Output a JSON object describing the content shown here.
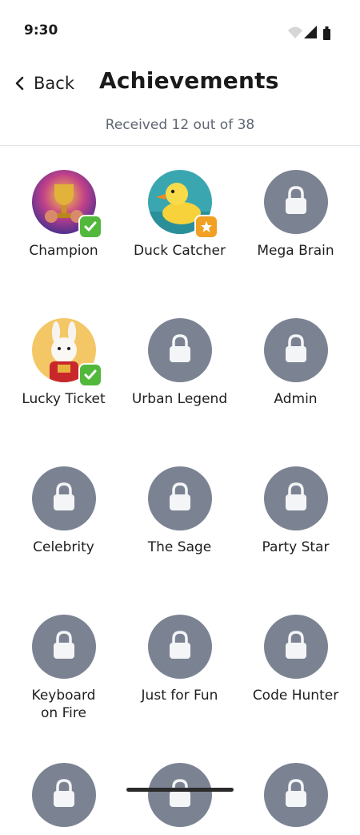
{
  "status": {
    "time": "9:30"
  },
  "header": {
    "back_label": "Back",
    "title": "Achievements"
  },
  "summary": {
    "text": "Received 12 out of 38"
  },
  "achievements": [
    {
      "label": "Champion",
      "state": "earned",
      "marker": "check-icon",
      "art": "trophy-art"
    },
    {
      "label": "Duck Catcher",
      "state": "earned",
      "marker": "star-icon",
      "art": "duck-art"
    },
    {
      "label": "Mega Brain",
      "state": "locked"
    },
    {
      "label": "Lucky Ticket",
      "state": "earned",
      "marker": "check-icon",
      "art": "rabbit-art"
    },
    {
      "label": "Urban Legend",
      "state": "locked"
    },
    {
      "label": "Admin",
      "state": "locked"
    },
    {
      "label": "Celebrity",
      "state": "locked"
    },
    {
      "label": "The Sage",
      "state": "locked"
    },
    {
      "label": "Party Star",
      "state": "locked"
    },
    {
      "label": "Keyboard\non Fire",
      "state": "locked"
    },
    {
      "label": "Just for Fun",
      "state": "locked"
    },
    {
      "label": "Code Hunter",
      "state": "locked"
    },
    {
      "label": "",
      "state": "locked"
    },
    {
      "label": "",
      "state": "locked"
    },
    {
      "label": "",
      "state": "locked"
    }
  ],
  "colors": {
    "locked_badge": "#7b8393",
    "check_marker": "#52b83c",
    "star_marker": "#f2a024",
    "subtitle_text": "#5f6673"
  }
}
